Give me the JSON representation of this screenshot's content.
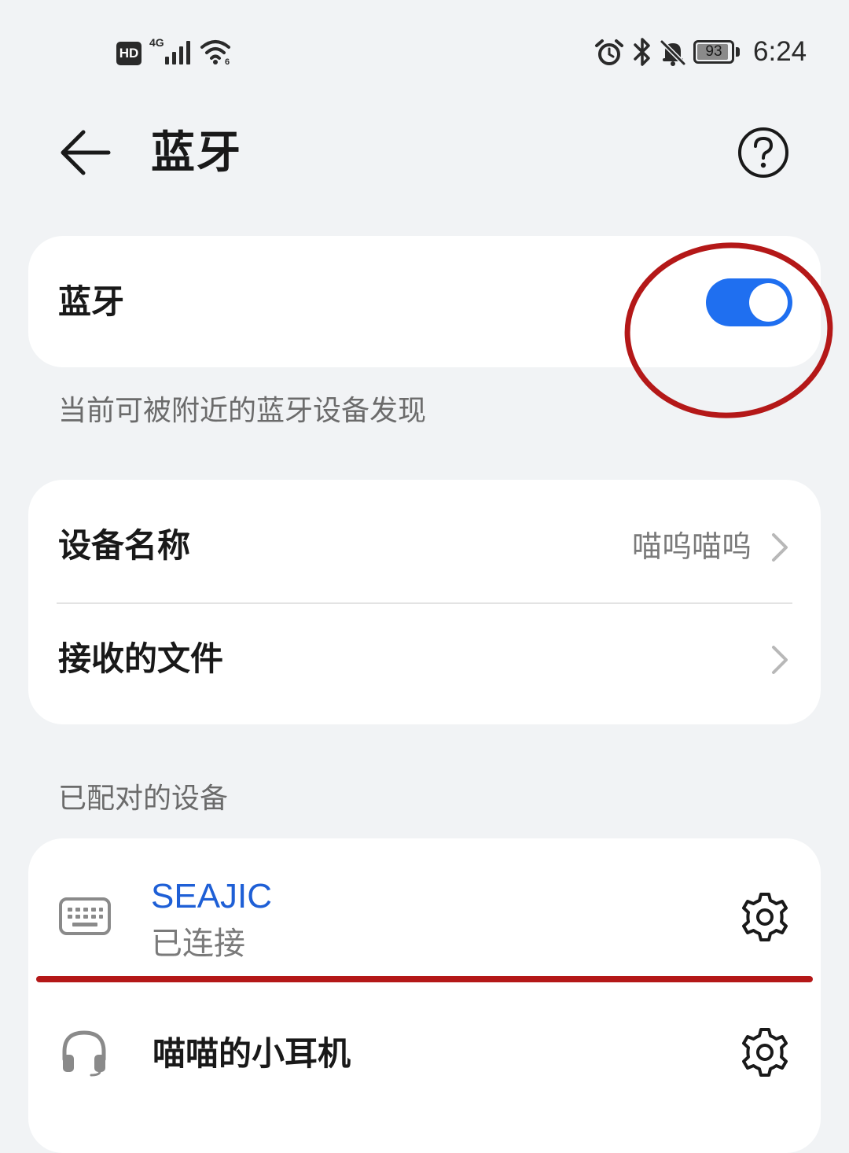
{
  "status_bar": {
    "hd_label": "HD",
    "network_label": "4G",
    "battery_level": "93",
    "battery_fraction": 0.93,
    "time": "6:24",
    "icons": [
      "signal-icon",
      "wifi-icon",
      "alarm-icon",
      "bluetooth-icon",
      "mute-icon",
      "battery-icon"
    ]
  },
  "header": {
    "title": "蓝牙",
    "back_icon": "arrow-left-icon",
    "help_icon": "question-circle-icon"
  },
  "bluetooth_toggle": {
    "label": "蓝牙",
    "enabled": true,
    "accent_color": "#1f6ff0"
  },
  "visibility_caption": "当前可被附近的蓝牙设备发现",
  "device_settings": {
    "device_name_label": "设备名称",
    "device_name_value": "喵呜喵呜",
    "received_files_label": "接收的文件"
  },
  "paired_section": {
    "caption": "已配对的设备",
    "devices": [
      {
        "name": "SEAJIC",
        "status": "已连接",
        "icon": "keyboard-icon",
        "settings_icon": "gear-icon"
      },
      {
        "name": "喵喵的小耳机",
        "icon": "headphones-icon",
        "settings_icon": "gear-icon"
      }
    ]
  },
  "annotation_color": "#b41818"
}
